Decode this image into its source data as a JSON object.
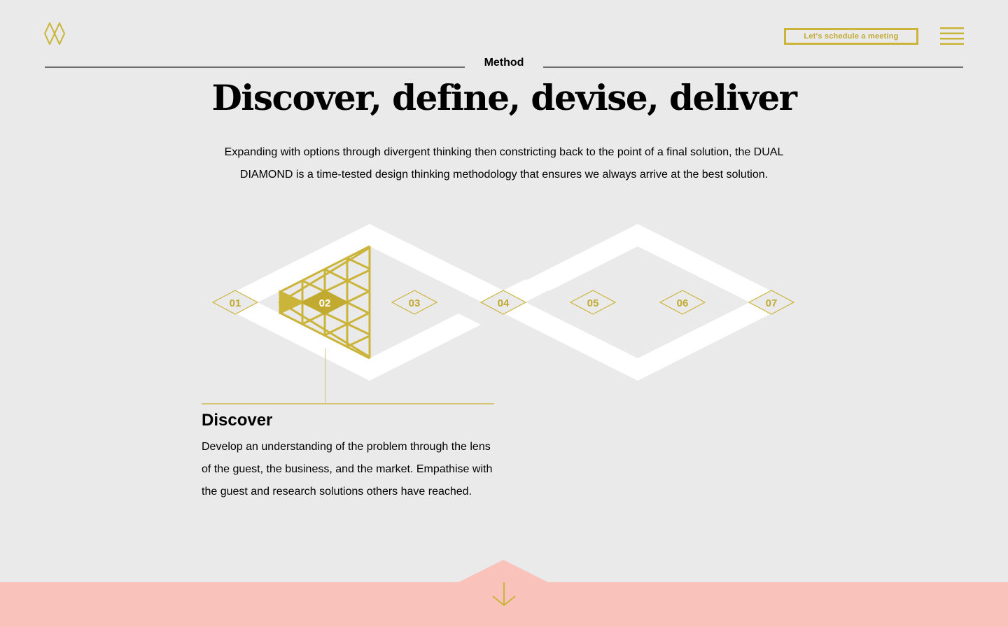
{
  "header": {
    "logo_icon": "dual-diamond-logo-icon",
    "cta_label": "Let's schedule a meeting",
    "menu_icon": "hamburger-menu-icon",
    "accent_color": "#cbb43a"
  },
  "section": {
    "label": "Method"
  },
  "hero": {
    "title": "Discover, define, devise, deliver",
    "intro": "Expanding with options through divergent thinking then constricting back to the point of a final solution, the DUAL DIAMOND is a time-tested design thinking methodology that ensures we always arrive at the best solution."
  },
  "diagram": {
    "active_step": "02",
    "steps": [
      {
        "label": "01"
      },
      {
        "label": "02"
      },
      {
        "label": "03"
      },
      {
        "label": "04"
      },
      {
        "label": "05"
      },
      {
        "label": "06"
      },
      {
        "label": "07"
      }
    ]
  },
  "detail": {
    "title": "Discover",
    "body": "Develop an understanding of the problem through the lens of the guest, the business, and the market. Empathise with the guest and research solutions others have reached."
  },
  "footer": {
    "background_color": "#f9c2bb",
    "scroll_icon": "arrow-down-icon"
  }
}
